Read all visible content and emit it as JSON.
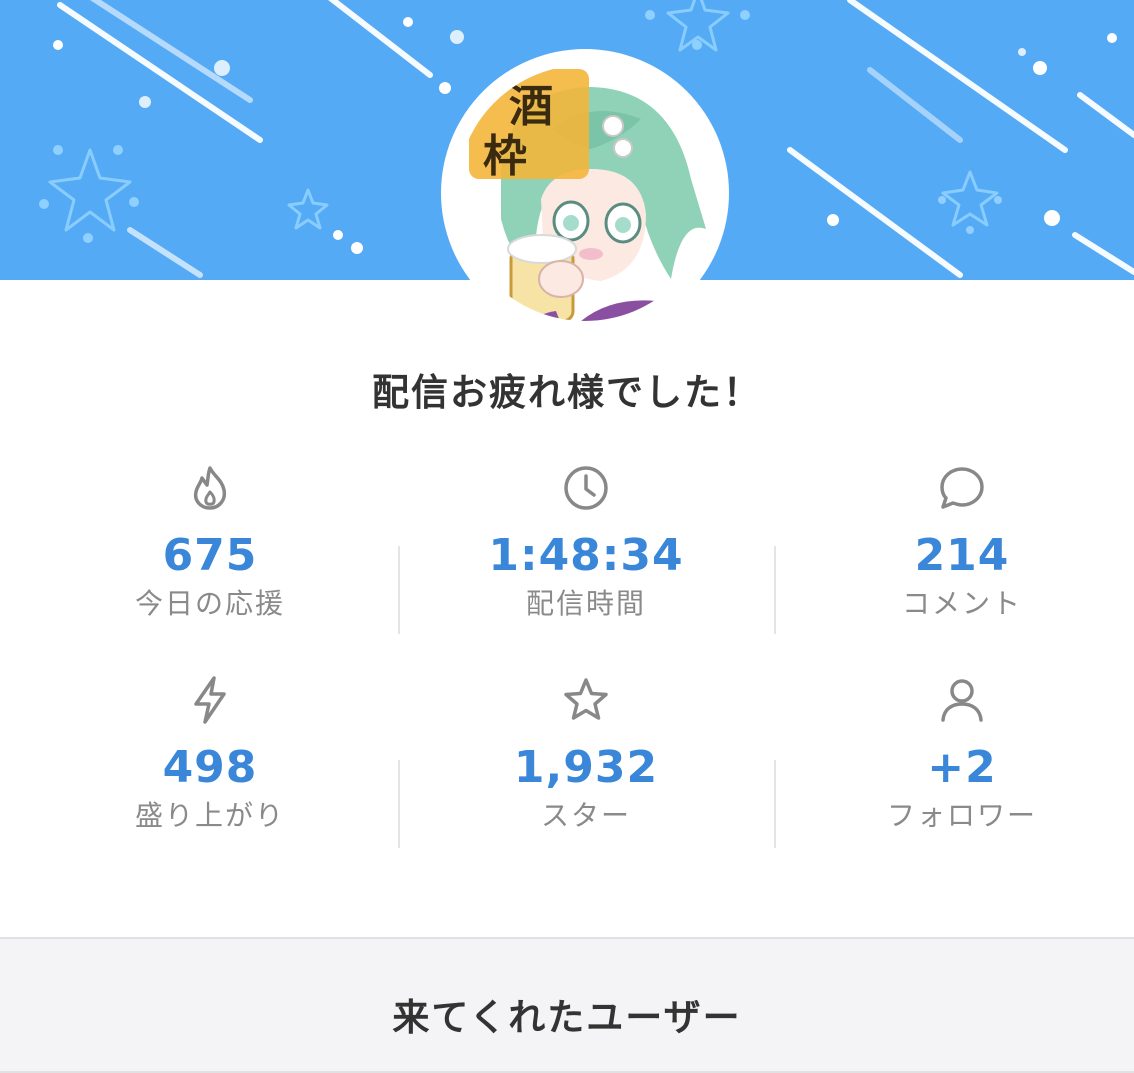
{
  "header": {
    "banner_color": "#55aaf5",
    "avatar_badge_text": "酒枠"
  },
  "headline": "配信お疲れ様でした！",
  "stats": [
    {
      "icon": "flame-icon",
      "value": "675",
      "label": "今日の応援"
    },
    {
      "icon": "clock-icon",
      "value": "1:48:34",
      "label": "配信時間"
    },
    {
      "icon": "speech-bubble-icon",
      "value": "214",
      "label": "コメント"
    },
    {
      "icon": "lightning-icon",
      "value": "498",
      "label": "盛り上がり"
    },
    {
      "icon": "star-icon",
      "value": "1,932",
      "label": "スター"
    },
    {
      "icon": "person-icon",
      "value": "+2",
      "label": "フォロワー"
    }
  ],
  "colors": {
    "accent": "#3a86d9",
    "label": "#8a8a8a",
    "title": "#333333"
  },
  "footer": {
    "title": "来てくれたユーザー"
  }
}
